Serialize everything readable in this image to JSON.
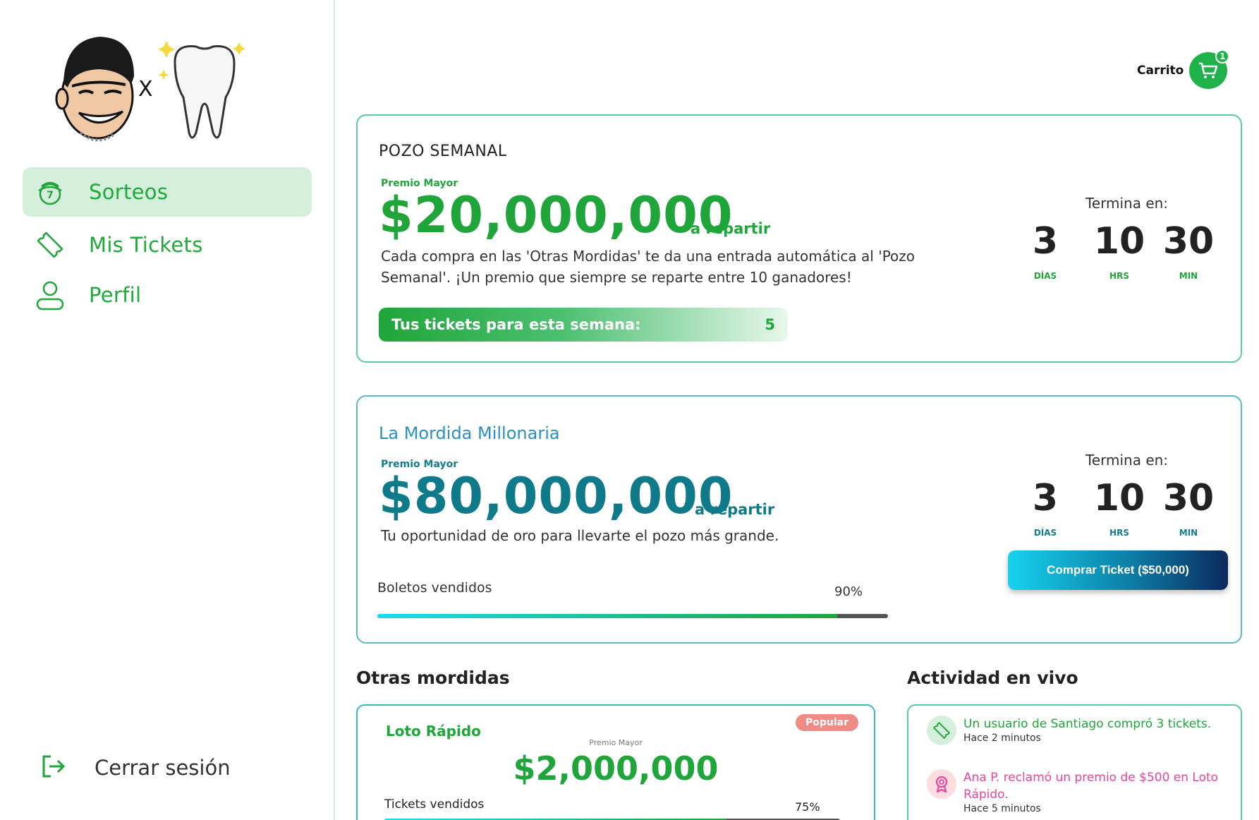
{
  "sidebar": {
    "logo_separator": "X",
    "items": [
      {
        "label": "Sorteos",
        "icon": "lottery-ball-icon",
        "active": true
      },
      {
        "label": "Mis Tickets",
        "icon": "ticket-icon",
        "active": false
      },
      {
        "label": "Perfil",
        "icon": "user-icon",
        "active": false
      }
    ],
    "logout_label": "Cerrar sesión",
    "logout_icon": "logout-icon"
  },
  "header": {
    "cart_label": "Carrito",
    "cart_count": "1",
    "cart_icon": "cart-icon"
  },
  "pozo_semanal": {
    "title": "POZO SEMANAL",
    "premio_label": "Premio Mayor",
    "amount": "$20,000,000",
    "repartir": "a repartir",
    "description": "Cada compra en las 'Otras Mordidas' te da una entrada automática al 'Pozo Semanal'. ¡Un premio que siempre se reparte entre 10 ganadores!",
    "tickets_label": "Tus tickets para esta semana:",
    "tickets_value": "5",
    "countdown": {
      "label": "Termina en:",
      "days": "3",
      "days_label": "DÍAS",
      "hours": "10",
      "hours_label": "HRS",
      "mins": "30",
      "mins_label": "MIN"
    }
  },
  "mordida_millonaria": {
    "title": "La Mordida Millonaria",
    "premio_label": "Premio Mayor",
    "amount": "$80,000,000",
    "repartir": "a repartir",
    "description": "Tu oportunidad de oro para llevarte el pozo más grande.",
    "sold_label": "Boletos vendidos",
    "sold_pct": "90%",
    "sold_fraction": 0.9,
    "buy_label": "Comprar Ticket ($50,000)",
    "countdown": {
      "label": "Termina en:",
      "days": "3",
      "days_label": "DÍAS",
      "hours": "10",
      "hours_label": "HRS",
      "mins": "30",
      "mins_label": "MIN"
    }
  },
  "otras": {
    "title": "Otras mordidas",
    "cards": [
      {
        "title": "Loto Rápido",
        "badge": "Popular",
        "premio_label": "Premio Mayor",
        "amount": "$2,000,000",
        "sold_label": "Tickets vendidos",
        "sold_pct": "75%",
        "sold_fraction": 0.75
      }
    ]
  },
  "actividad": {
    "title": "Actividad en vivo",
    "items": [
      {
        "icon": "ticket-icon",
        "message": "Un usuario de Santiago compró 3 tickets.",
        "time": "Hace 2 minutos",
        "color": "#1fa53a",
        "bg": "#d4efdb"
      },
      {
        "icon": "award-icon",
        "message": "Ana P. reclamó un premio de $500 en Loto Rápido.",
        "time": "Hace 5 minutos",
        "color": "#e8459b",
        "bg": "#fbdde0"
      }
    ]
  }
}
